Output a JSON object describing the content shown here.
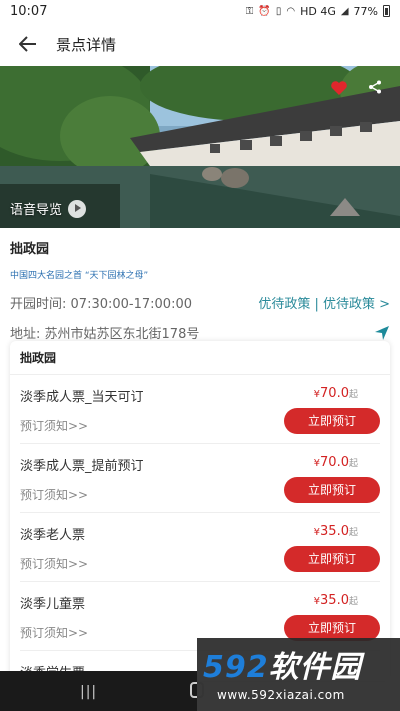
{
  "status_bar": {
    "time": "10:07",
    "battery": "77%",
    "signal_text": "HD 4G"
  },
  "app_bar": {
    "title": "景点详情",
    "back_icon": "arrow-left-icon"
  },
  "hero": {
    "audio_guide_label": "语音导览",
    "favorite_icon": "heart-icon",
    "share_icon": "share-icon"
  },
  "spot": {
    "name": "拙政园",
    "tagline": "中国四大名园之首  “天下园林之母”",
    "hours_label": "开园时间:",
    "hours_value": "07:30:00-17:00:00",
    "policy_link": "优待政策 | 优待政策 >",
    "address_label": "地址:",
    "address_value": "苏州市姑苏区东北街178号"
  },
  "ticket_card": {
    "title": "拙政园",
    "tickets": [
      {
        "name": "淡季成人票_当天可订",
        "currency": "¥",
        "price": "70.0",
        "unit": "起",
        "notice": "预订须知>>",
        "button": "立即预订"
      },
      {
        "name": "淡季成人票_提前预订",
        "currency": "¥",
        "price": "70.0",
        "unit": "起",
        "notice": "预订须知>>",
        "button": "立即预订"
      },
      {
        "name": "淡季老人票",
        "currency": "¥",
        "price": "35.0",
        "unit": "起",
        "notice": "预订须知>>",
        "button": "立即预订"
      },
      {
        "name": "淡季儿童票",
        "currency": "¥",
        "price": "35.0",
        "unit": "起",
        "notice": "预订须知>>",
        "button": "立即预订"
      },
      {
        "name": "淡季学生票",
        "currency": "",
        "price": "",
        "unit": "",
        "notice": "",
        "button": ""
      }
    ]
  },
  "watermark": {
    "logo_num": "592",
    "logo_cn": "软件园",
    "url": "www.592xiazai.com"
  },
  "colors": {
    "accent_red": "#d42a2a",
    "price_red": "#d32222",
    "link_teal": "#2a8a9a",
    "tag_blue": "#2a6fb0"
  }
}
